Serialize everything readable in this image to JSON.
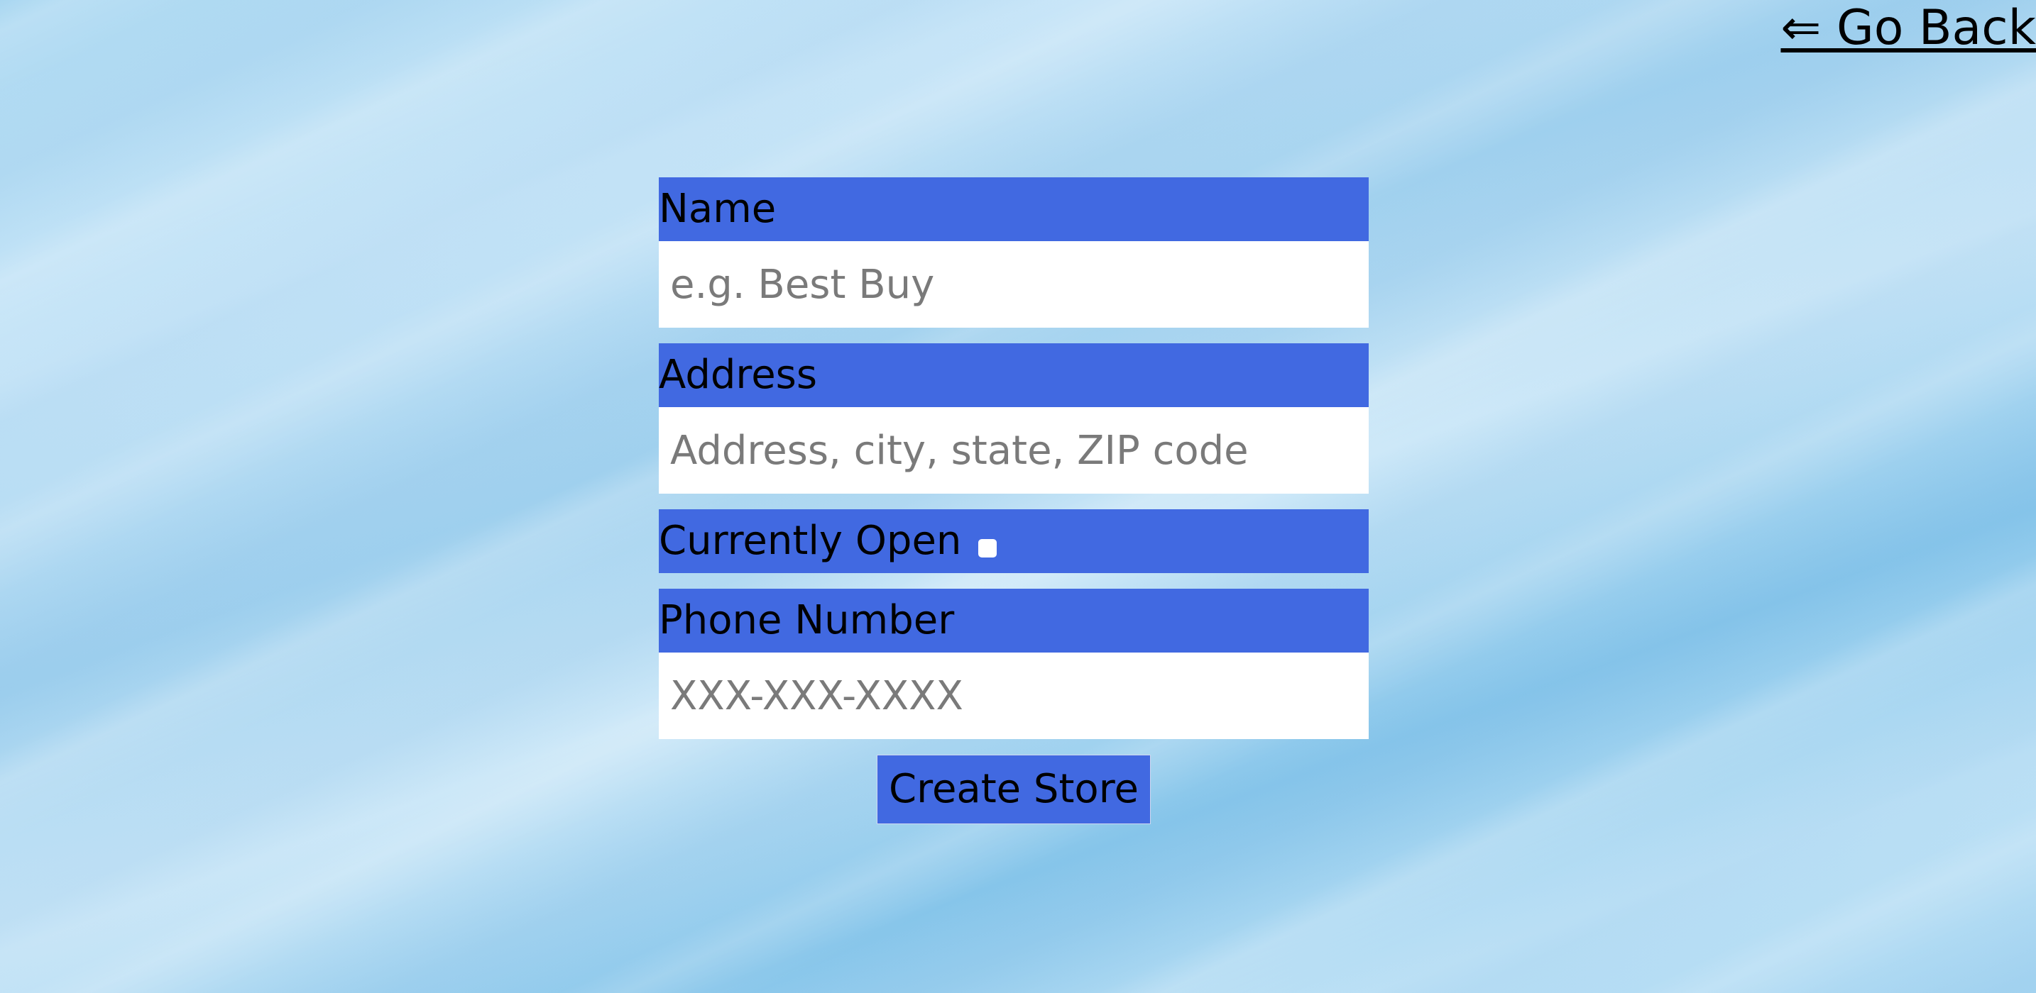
{
  "nav": {
    "go_back_label": "⇐ Go Back"
  },
  "form": {
    "name": {
      "label": "Name",
      "placeholder": "e.g. Best Buy",
      "value": ""
    },
    "address": {
      "label": "Address",
      "placeholder": "Address, city, state, ZIP code",
      "value": ""
    },
    "currently_open": {
      "label": "Currently Open",
      "checked": false
    },
    "phone": {
      "label": "Phone Number",
      "placeholder": "XXX-XXX-XXXX",
      "value": ""
    },
    "submit_label": "Create Store"
  },
  "colors": {
    "accent": "#4169e1",
    "input_bg": "#ffffff",
    "placeholder": "#7a7a7a"
  }
}
